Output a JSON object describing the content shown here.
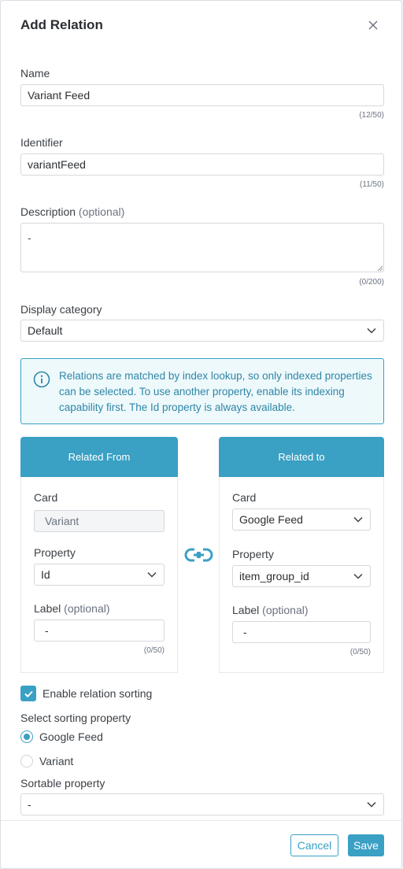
{
  "modal": {
    "title": "Add Relation"
  },
  "name": {
    "label": "Name",
    "value": "Variant Feed",
    "counter": "(12/50)"
  },
  "identifier": {
    "label": "Identifier",
    "value": "variantFeed",
    "counter": "(11/50)"
  },
  "description": {
    "label": "Description",
    "optional": "(optional)",
    "value": "-",
    "counter": "(0/200)"
  },
  "display_category": {
    "label": "Display category",
    "value": "Default"
  },
  "info": {
    "text": "Relations are matched by index lookup, so only indexed properties can be selected. To use another property, enable its indexing capability first. The Id property is always available."
  },
  "related_from": {
    "header": "Related From",
    "card_label": "Card",
    "card_value": "Variant",
    "property_label": "Property",
    "property_value": "Id",
    "label_label": "Label",
    "label_optional": "(optional)",
    "label_value": "-",
    "label_counter": "(0/50)"
  },
  "related_to": {
    "header": "Related to",
    "card_label": "Card",
    "card_value": "Google Feed",
    "property_label": "Property",
    "property_value": "item_group_id",
    "label_label": "Label",
    "label_optional": "(optional)",
    "label_value": "-",
    "label_counter": "(0/50)"
  },
  "sorting": {
    "enable_label": "Enable relation sorting",
    "enabled": true,
    "select_label": "Select sorting property",
    "options": [
      "Google Feed",
      "Variant"
    ],
    "selected": "Google Feed",
    "sortable_label": "Sortable property",
    "sortable_value": "-"
  },
  "footer": {
    "cancel_label": "Cancel",
    "save_label": "Save"
  },
  "colors": {
    "accent": "#3aa0c4",
    "info_bg": "#eef9fb"
  }
}
